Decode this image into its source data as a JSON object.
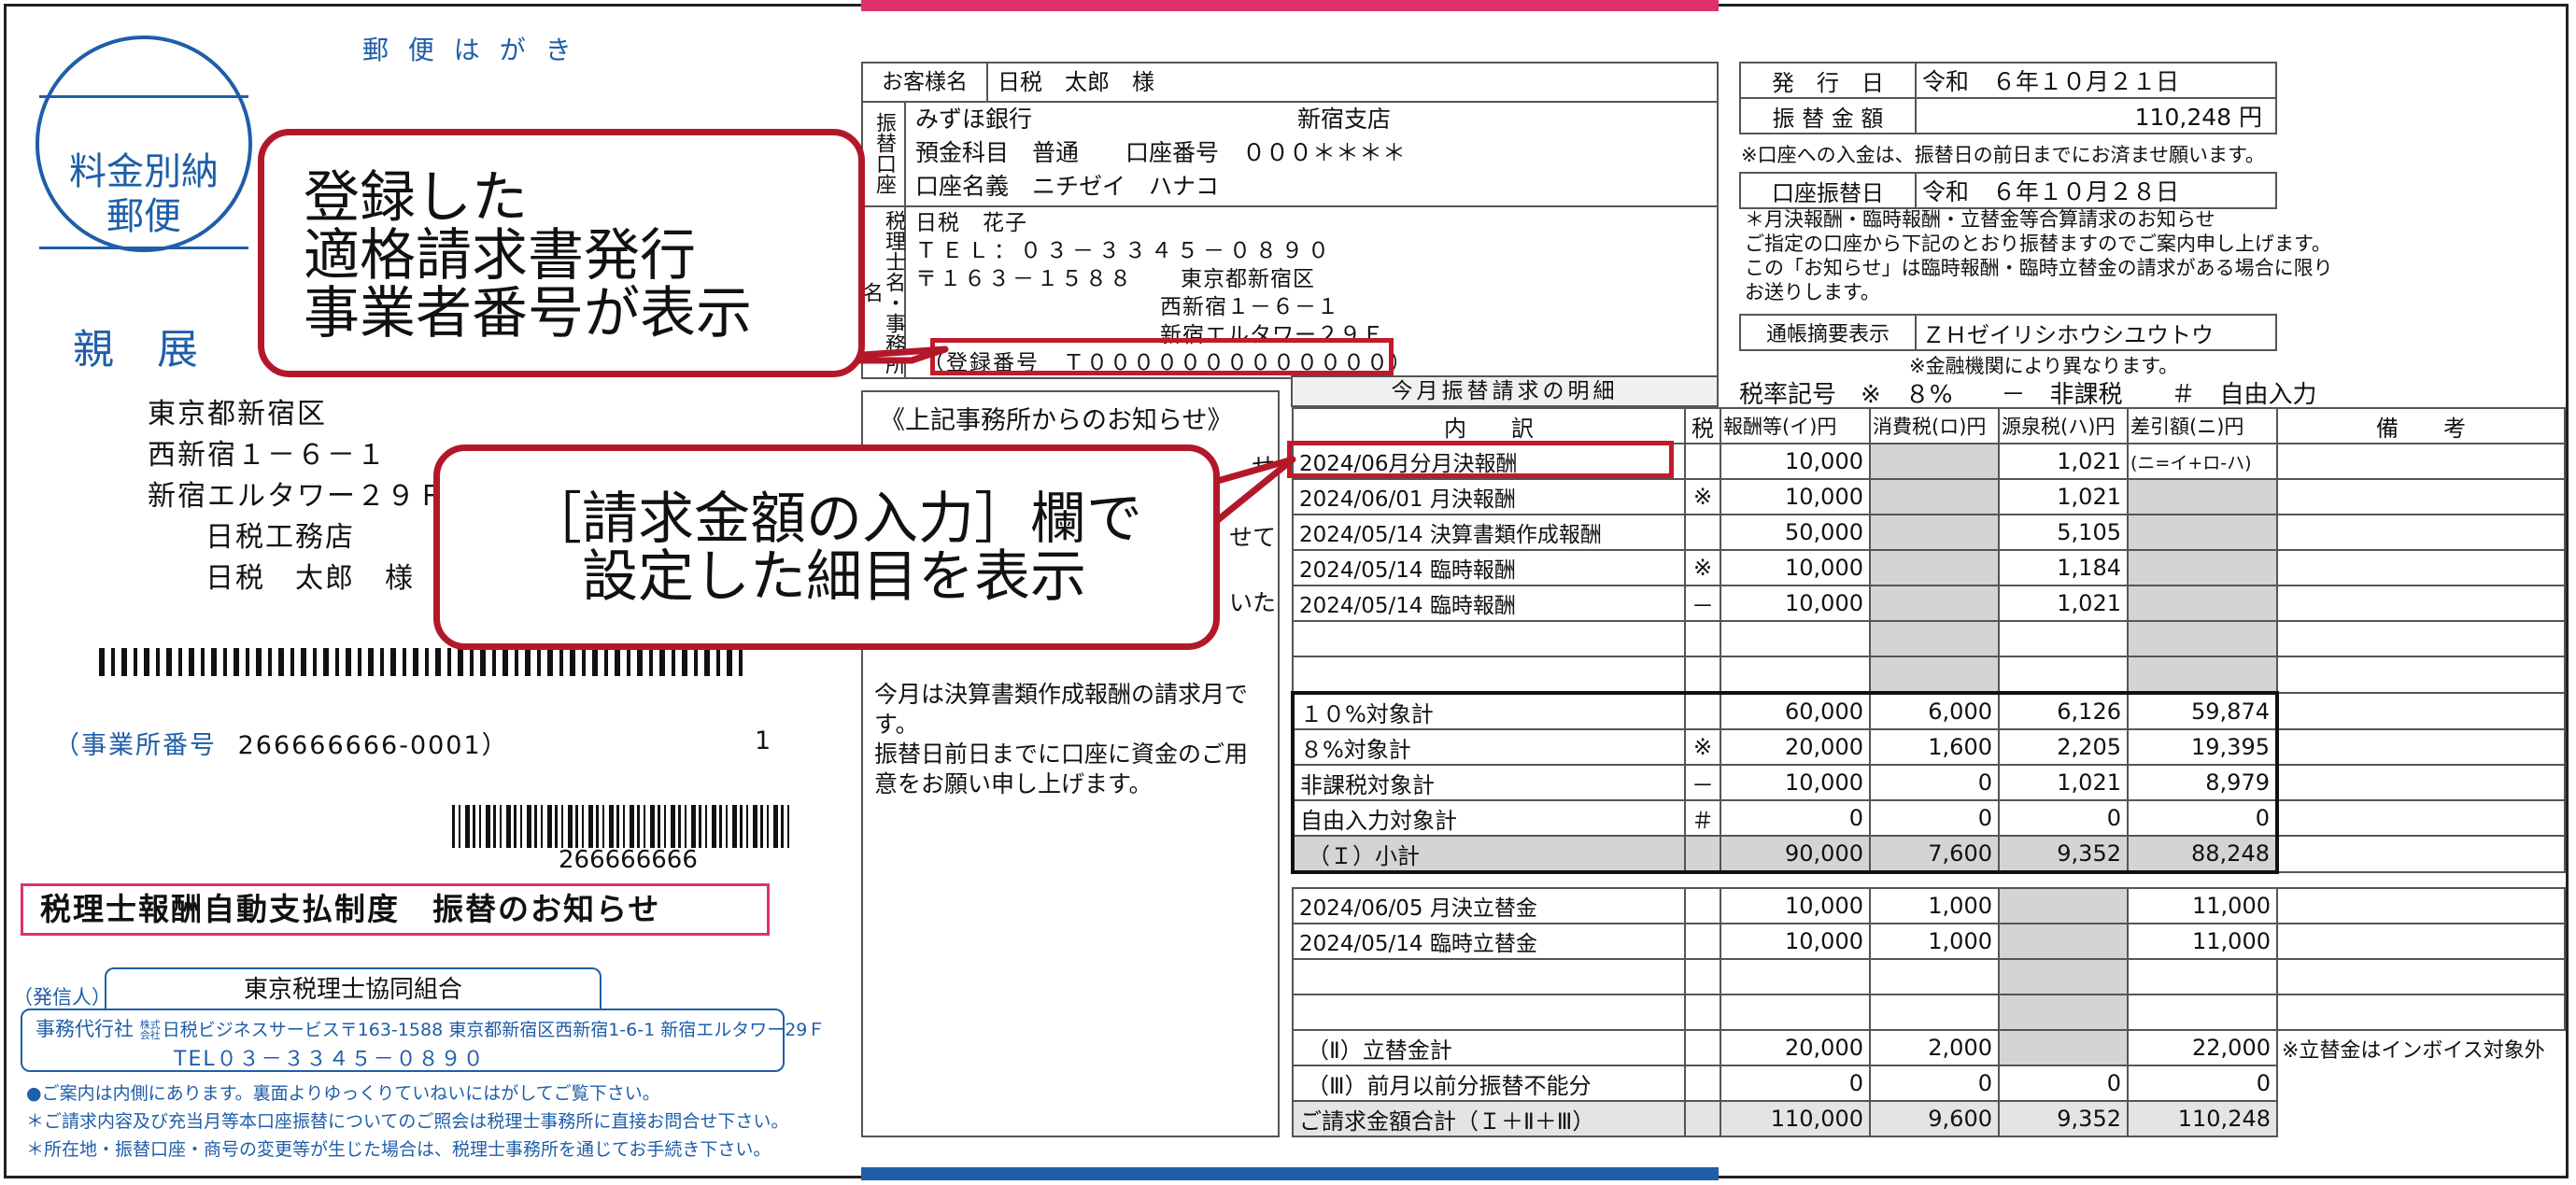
{
  "postcard": "郵 便 は が き",
  "stamp": {
    "line1": "料金別納",
    "line2": "郵便"
  },
  "shinten": "親 展",
  "recipient": {
    "addr1": "東京都新宿区",
    "addr2": "西新宿１－６－１",
    "addr3": "新宿エルタワー２９Ｆ",
    "office": "日税工務店",
    "name": "日税　太郎　様"
  },
  "office_no_label": "（事業所番号",
  "office_no": "266666666-0001）",
  "office_no_count": "1",
  "barcode_number": "266666666",
  "notice_title": "税理士報酬自動支払制度　振替のお知らせ",
  "sender": {
    "label": "（発信人）",
    "org": "東京税理士協同組合",
    "agent": "事務代行社",
    "company_small": "株式\n会社",
    "company": "日税ビジネスサービス〒163-1588 東京都新宿区西新宿1-6-1 新宿エルタワー29Ｆ",
    "tel": "TEL０３－３３４５－０８９０"
  },
  "footnotes": [
    "●ご案内は内側にあります。裏面よりゆっくりていねいにはがしてご覧下さい。",
    "＊ご請求内容及び充当月等本口座振替についてのご照会は税理士事務所に直接お問合せ下さい。",
    "＊所在地・振替口座・商号の変更等が生じた場合は、税理士事務所を通じてお手続き下さい。"
  ],
  "customer": {
    "label": "お客様名",
    "value": "日税　太郎　様"
  },
  "account": {
    "label": "振替口座",
    "bank": "みずほ銀行",
    "branch": "新宿支店",
    "type_line": "預金科目　普通　　口座番号　０００＊＊＊＊",
    "holder_line": "口座名義　ニチゼイ　ハナコ"
  },
  "accountant": {
    "label": "税理士名・事務所名",
    "name": "日税　花子",
    "tel": "ＴＥＬ：０３－３３４５－０８９０",
    "zip": "〒１６３－１５８８",
    "addr1": "東京都新宿区",
    "addr2": "西新宿１－６－１",
    "addr3": "新宿エルタワー２９Ｆ",
    "reg": "（登録番号　Ｔ０００００００００００００）"
  },
  "office_notice": {
    "title": "《上記事務所からのお知らせ》",
    "frag1": "せ",
    "frag2": "せて",
    "frag3": "いた",
    "body": "今月は決算書類作成報酬の請求月です。\n振替日前日までに口座に資金のご用意をお願い申し上げます。"
  },
  "issue": {
    "label": "発　行　日",
    "value": "令和　６年１０月２１日"
  },
  "amount": {
    "label": "振 替 金 額",
    "value": "110,248 円"
  },
  "note1": "※口座への入金は、振替日の前日までにお済ませ願います。",
  "transfer_date": {
    "label": "口座振替日",
    "value": "令和　６年１０月２８日"
  },
  "info_text": "＊月決報酬・臨時報酬・立替金等合算請求のお知らせ\nご指定の口座から下記のとおり振替ますのでご案内申し上げます。\nこの「お知らせ」は臨時報酬・臨時立替金の請求がある場合に限り\nお送りします。",
  "passbook": {
    "label": "通帳摘要表示",
    "value": "ＺＨゼイリシホウシユウトウ"
  },
  "passbook_note": "※金融機関により異なります。",
  "detail_title": "今月振替請求の明細",
  "tax_legend": "税率記号　※　８%　　－　非課税　　＃　自由入力",
  "headers": {
    "desc": "内　　訳",
    "tax": "税",
    "fee": "報酬等(イ)円",
    "ctax": "消費税(ロ)円",
    "wtax": "源泉税(ハ)円",
    "net": "差引額(ニ)円",
    "note": "備　　考"
  },
  "rows": [
    {
      "desc": "2024/06月分月決報酬",
      "tax": "",
      "fee": "10,000",
      "ctax": "",
      "wtax": "1,021",
      "net": "(ニ=イ+ロ-ハ)"
    },
    {
      "desc": "2024/06/01 月決報酬",
      "tax": "※",
      "fee": "10,000",
      "ctax": "",
      "wtax": "1,021",
      "net": ""
    },
    {
      "desc": "2024/05/14 決算書類作成報酬",
      "tax": "",
      "fee": "50,000",
      "ctax": "",
      "wtax": "5,105",
      "net": ""
    },
    {
      "desc": "2024/05/14 臨時報酬",
      "tax": "※",
      "fee": "10,000",
      "ctax": "",
      "wtax": "1,184",
      "net": ""
    },
    {
      "desc": "2024/05/14 臨時報酬",
      "tax": "－",
      "fee": "10,000",
      "ctax": "",
      "wtax": "1,021",
      "net": ""
    },
    {
      "desc": "",
      "tax": "",
      "fee": "",
      "ctax": "",
      "wtax": "",
      "net": ""
    },
    {
      "desc": "",
      "tax": "",
      "fee": "",
      "ctax": "",
      "wtax": "",
      "net": ""
    }
  ],
  "totals": [
    {
      "desc": "１０%対象計",
      "tax": "",
      "fee": "60,000",
      "ctax": "6,000",
      "wtax": "6,126",
      "net": "59,874"
    },
    {
      "desc": "８%対象計",
      "tax": "※",
      "fee": "20,000",
      "ctax": "1,600",
      "wtax": "2,205",
      "net": "19,395"
    },
    {
      "desc": "非課税対象計",
      "tax": "－",
      "fee": "10,000",
      "ctax": "0",
      "wtax": "1,021",
      "net": "8,979"
    },
    {
      "desc": "自由入力対象計",
      "tax": "＃",
      "fee": "0",
      "ctax": "0",
      "wtax": "0",
      "net": "0"
    },
    {
      "desc": "（Ｉ）小計",
      "tax": "",
      "fee": "90,000",
      "ctax": "7,600",
      "wtax": "9,352",
      "net": "88,248"
    }
  ],
  "advances": [
    {
      "desc": "2024/06/05 月決立替金",
      "fee": "10,000",
      "ctax": "1,000",
      "net": "11,000"
    },
    {
      "desc": "2024/05/14 臨時立替金",
      "fee": "10,000",
      "ctax": "1,000",
      "net": "11,000"
    },
    {
      "desc": "",
      "fee": "",
      "ctax": "",
      "net": ""
    },
    {
      "desc": "",
      "fee": "",
      "ctax": "",
      "net": ""
    }
  ],
  "adv_total": {
    "desc": "（Ⅱ）立替金計",
    "fee": "20,000",
    "ctax": "2,000",
    "wtax": "",
    "net": "22,000",
    "note": "※立替金はインボイス対象外"
  },
  "prev_unpaid": {
    "desc": "（Ⅲ）前月以前分振替不能分",
    "fee": "0",
    "ctax": "0",
    "wtax": "0",
    "net": "0"
  },
  "grand_total": {
    "desc": "ご請求金額合計（Ｉ＋Ⅱ＋Ⅲ）",
    "fee": "110,000",
    "ctax": "9,600",
    "wtax": "9,352",
    "net": "110,248"
  },
  "callout1": "登録した\n適格請求書発行\n事業者番号が表示",
  "callout2": "［請求金額の入力］欄で\n　設定した細目を表示",
  "colors": {
    "callout_border": "#b3182a",
    "highlight": "#c2192b",
    "blue": "#1f5ea8"
  }
}
